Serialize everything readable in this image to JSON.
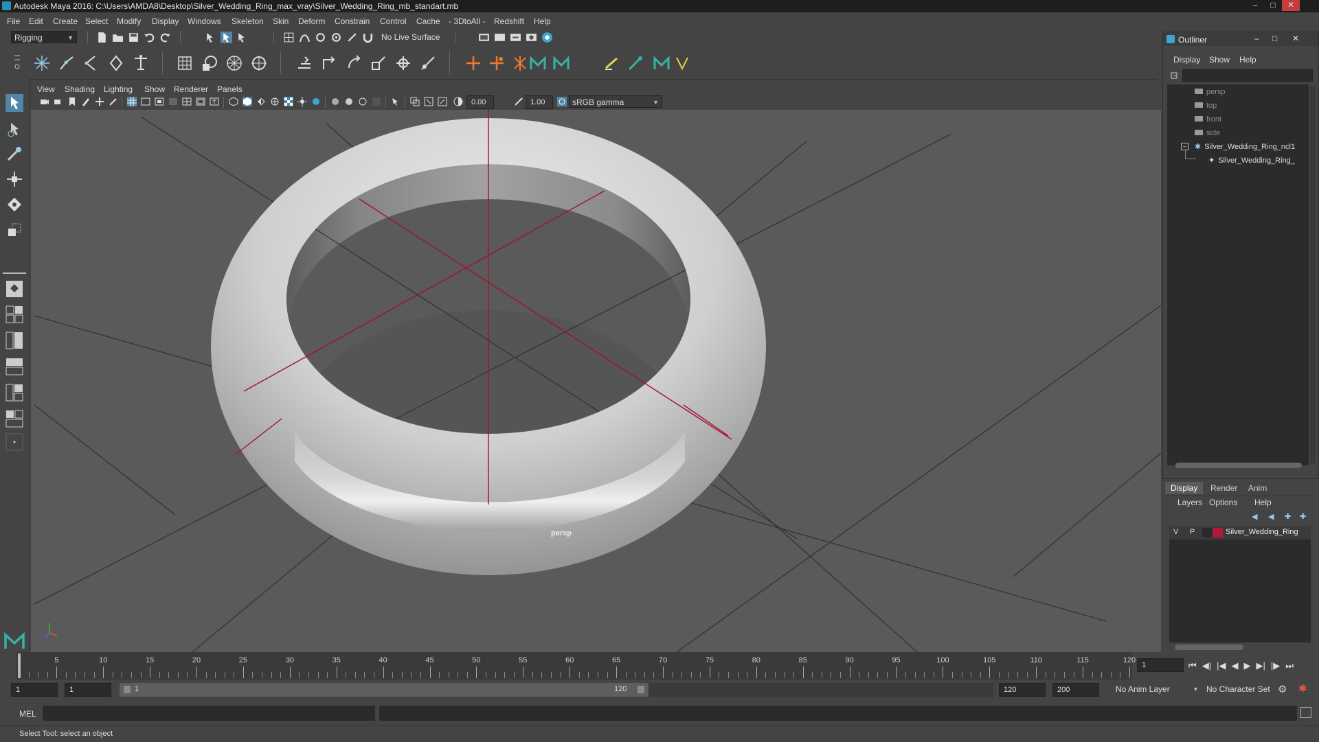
{
  "window": {
    "title": "Autodesk Maya 2016: C:\\Users\\AMDA8\\Desktop\\Silver_Wedding_Ring_max_vray\\Silver_Wedding_Ring_mb_standart.mb",
    "controls": [
      "–",
      "□",
      "✕"
    ]
  },
  "menubar": {
    "items": [
      "File",
      "Edit",
      "Create",
      "Select",
      "Modify",
      "Display",
      "Windows",
      "Skeleton",
      "Skin",
      "Deform",
      "Constrain",
      "Control",
      "Cache",
      "- 3DtoAll -",
      "Redshift",
      "Help"
    ]
  },
  "statusline": {
    "menuset": "Rigging",
    "live_surface": "No Live Surface"
  },
  "viewport": {
    "menus": [
      "View",
      "Shading",
      "Lighting",
      "Show",
      "Renderer",
      "Panels"
    ],
    "exposure": "0.00",
    "gamma": "1.00",
    "color_space": "sRGB gamma",
    "camera_label": "persp"
  },
  "outliner": {
    "title": "Outliner",
    "menus": [
      "Display",
      "Show",
      "Help"
    ],
    "items": [
      {
        "label": "persp"
      },
      {
        "label": "top"
      },
      {
        "label": "front"
      },
      {
        "label": "side"
      },
      {
        "label": "Silver_Wedding_Ring_ncl1"
      },
      {
        "label": "Silver_Wedding_Ring_"
      }
    ]
  },
  "layer_panel": {
    "tabs": [
      "Display",
      "Render",
      "Anim"
    ],
    "menus": [
      "Layers",
      "Options",
      "Help"
    ],
    "layer": {
      "visible": "V",
      "playback": "P",
      "name": "Silver_Wedding_Ring",
      "color": "#b3173a"
    }
  },
  "timeline": {
    "labels": [
      "1",
      "5",
      "10",
      "15",
      "20",
      "25",
      "30",
      "35",
      "40",
      "45",
      "50",
      "55",
      "60",
      "65",
      "70",
      "75",
      "80",
      "85",
      "90",
      "95",
      "100",
      "105",
      "110",
      "115",
      "120"
    ],
    "current_frame": "1"
  },
  "range": {
    "start": "1",
    "playback_start": "1",
    "slider_start": "1",
    "slider_end": "120",
    "playback_end": "120",
    "end": "200",
    "anim_layer": "No Anim Layer",
    "character_set": "No Character Set"
  },
  "command_line": {
    "label": "MEL"
  },
  "help_line": {
    "text": "Select Tool: select an object"
  },
  "colors": {
    "accent": "#5285a6",
    "ring_grid_red": "#a3102e"
  }
}
